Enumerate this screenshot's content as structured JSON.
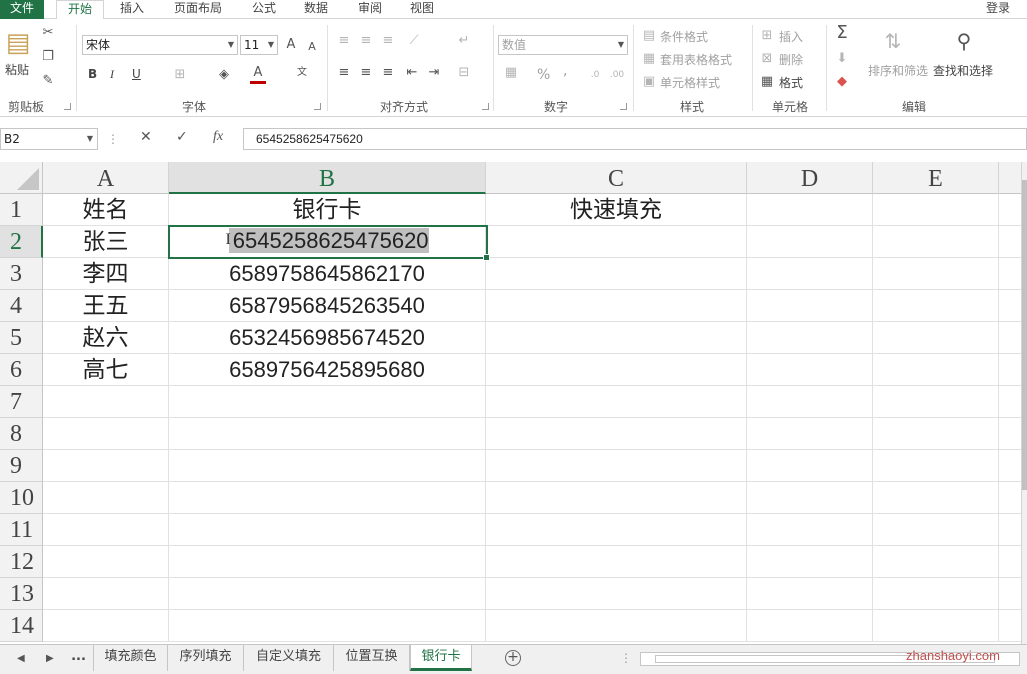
{
  "tabs": [
    "文件",
    "开始",
    "插入",
    "页面布局",
    "公式",
    "数据",
    "审阅",
    "视图"
  ],
  "active_tab": "开始",
  "login_label": "登录",
  "clipboard": {
    "paste_label": "粘贴",
    "group_label": "剪贴板"
  },
  "font": {
    "name": "宋体",
    "size": "11",
    "bold": "B",
    "italic": "I",
    "underline": "U",
    "group_label": "字体"
  },
  "alignment": {
    "group_label": "对齐方式"
  },
  "number": {
    "format": "数值",
    "percent": "%",
    "comma": ",",
    "group_label": "数字"
  },
  "styles": {
    "conditional": "条件格式",
    "table": "套用表格格式",
    "cell_styles": "单元格样式",
    "group_label": "样式"
  },
  "cells": {
    "insert": "插入",
    "delete": "删除",
    "format": "格式",
    "group_label": "单元格"
  },
  "editing": {
    "sort_filter": "排序和筛选",
    "find_select": "查找和选择",
    "group_label": "编辑"
  },
  "formula_bar": {
    "name_box": "B2",
    "value": "6545258625475620"
  },
  "columns": [
    "A",
    "B",
    "C",
    "D",
    "E"
  ],
  "rows": [
    "1",
    "2",
    "3",
    "4",
    "5",
    "6",
    "7",
    "8",
    "9",
    "10",
    "11",
    "12",
    "13",
    "14"
  ],
  "sheet": {
    "header": {
      "a": "姓名",
      "b": "银行卡",
      "c": "快速填充"
    },
    "records": [
      {
        "name": "张三",
        "card": "6545258625475620"
      },
      {
        "name": "李四",
        "card": "6589758645862170"
      },
      {
        "name": "王五",
        "card": "6587956845263540"
      },
      {
        "name": "赵六",
        "card": "6532456985674520"
      },
      {
        "name": "高七",
        "card": "6589756425895680"
      }
    ]
  },
  "sheet_tabs": [
    "...",
    "填充颜色",
    "序列填充",
    "自定义填充",
    "位置互换",
    "银行卡"
  ],
  "active_sheet": "银行卡",
  "watermark": "zhanshaoyi.com",
  "colors": {
    "accent": "#217346",
    "selection_fill": "#bfbfbf"
  }
}
